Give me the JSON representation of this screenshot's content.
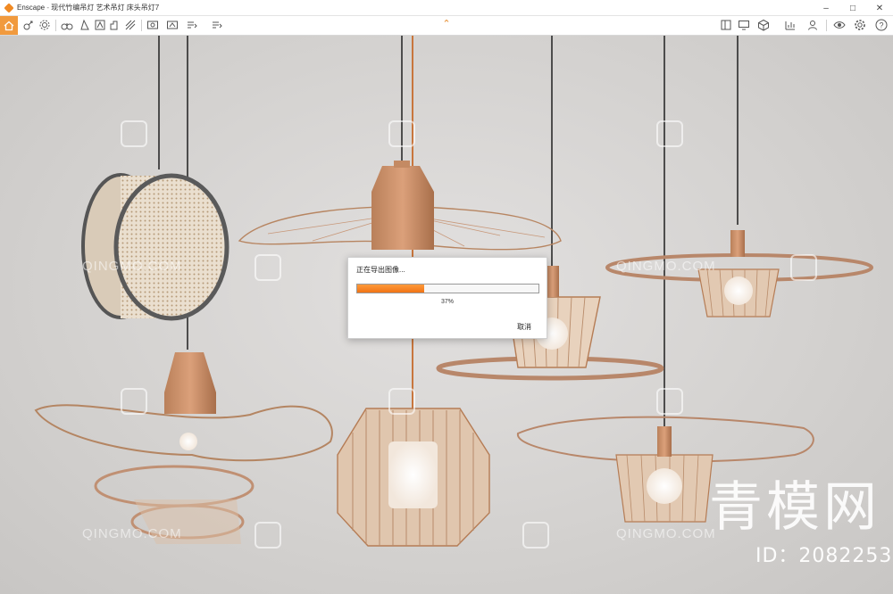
{
  "window": {
    "app_name": "Enscape",
    "title_separator": "-",
    "document_title": "现代竹编吊灯 艺术吊灯 床头吊灯7",
    "controls": [
      "–",
      "□",
      "✕"
    ]
  },
  "toolbar": {
    "left_icons": [
      "home-icon",
      "asset-library-icon",
      "settings-icon",
      "binoculars-icon",
      "walk-mode-icon",
      "fly-mode-icon",
      "image-icon",
      "video-icon",
      "panorama-icon",
      "sun-icon",
      "grid-icon",
      "orbit-icon",
      "screenshot-icon",
      "batch-render-icon",
      "export-icon",
      "export-dropdown-icon"
    ],
    "right_icons": [
      "sync-views-icon",
      "monitor-icon",
      "book-icon",
      "cube-icon",
      "chart-icon",
      "dropdown-icon",
      "users-icon",
      "eye-icon",
      "gear-icon",
      "help-icon"
    ],
    "collapse_glyph": "⌃"
  },
  "dialog": {
    "title": "正在导出图像...",
    "progress": 0.37,
    "percent_text": "37%",
    "cancel_label": "取消"
  },
  "watermarks": {
    "site_text": "QINGMO.COM",
    "brand_text": "青模网",
    "id_text": "ID：2082253"
  },
  "colors": {
    "accent": "#f08a24",
    "progress_fill": "#f07414",
    "background": "#d6d4d2"
  }
}
